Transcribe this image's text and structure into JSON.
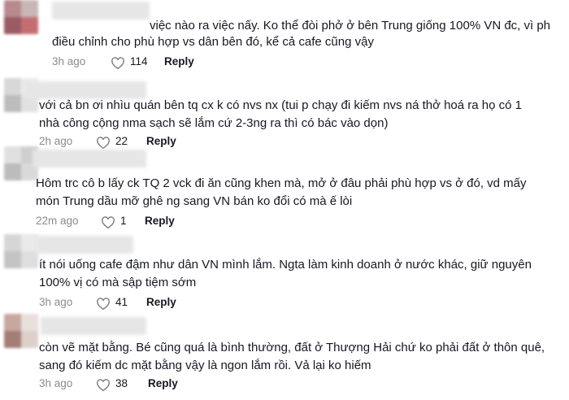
{
  "colors": {
    "text": "#161823",
    "muted": "#8a8b91",
    "heart_stroke": "#777777"
  },
  "icons": {
    "like": "heart-outline-icon"
  },
  "comments": [
    {
      "lines": [
        "việc nào ra việc nấy. Ko thể đòi phở ở bên Trung giống 100% VN đc, vì ph",
        "điều chỉnh cho phù hợp vs dân bên đó, kể cả cafe cũng vậy"
      ],
      "time": "3h ago",
      "likes": "114",
      "reply": "Reply"
    },
    {
      "lines": [
        "với cả bn ơi nhìu quán bên tq cx k có nvs nx (tui p chạy đi kiếm nvs ná thở hoá ra họ có 1",
        "nhà công cộng nma sạch sẽ lắm cứ 2-3ng ra thì có bác vào dọn)"
      ],
      "time": "2h ago",
      "likes": "22",
      "reply": "Reply"
    },
    {
      "lines": [
        "Hôm trc cô b lấy ck TQ 2 vck đi ăn cũng khen mà, mở ở đâu phải phù hợp vs ở đó, vd mấy",
        "món Trung dầu mỡ ghê ng sang VN bán ko đổi có mà ế lòi"
      ],
      "time": "22m ago",
      "likes": "1",
      "reply": "Reply"
    },
    {
      "lines": [
        "ít nói uống cafe đậm như dân VN mình lắm. Ngta làm kinh doanh ở nước khác, giữ nguyên",
        "100% vị có mà sập tiệm sớm"
      ],
      "time": "3h ago",
      "likes": "41",
      "reply": "Reply"
    },
    {
      "lines": [
        "còn vẽ mặt bằng. Bé cũng quá là bình thường, đất ở Thượng Hải chứ ko phải đất ở thôn quê,",
        "sang đó kiếm dc mặt bằng vậy là ngon lắm rồi. Vả lại ko hiếm"
      ],
      "time": "3h ago",
      "likes": "38",
      "reply": "Reply"
    }
  ]
}
